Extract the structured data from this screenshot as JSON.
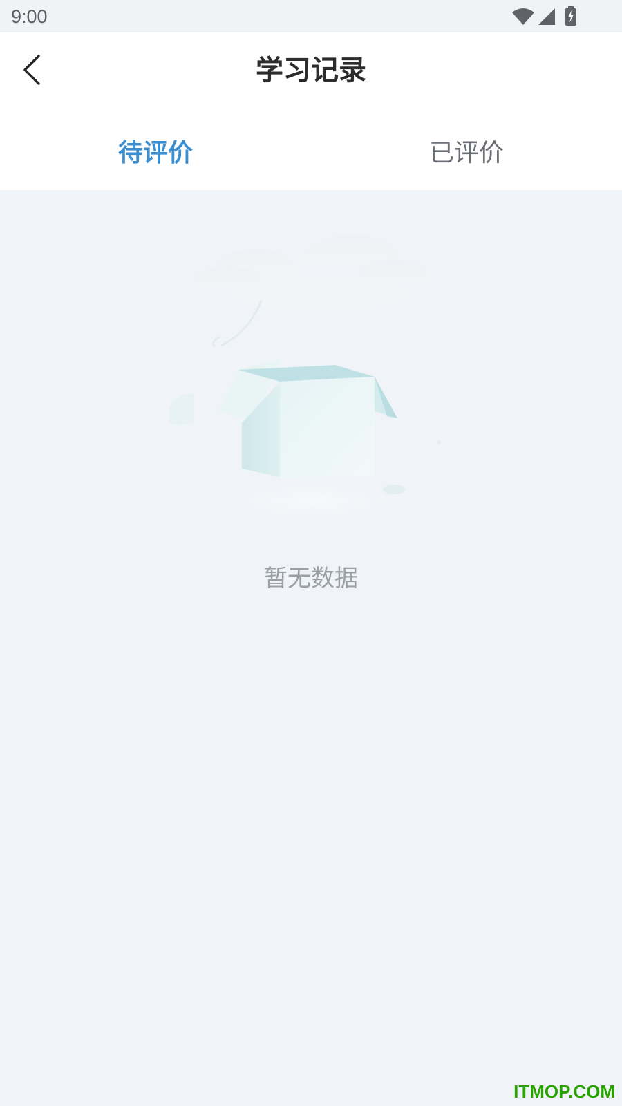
{
  "status_bar": {
    "time": "9:00",
    "icons": [
      "wifi-icon",
      "signal-icon",
      "battery-charging-icon"
    ]
  },
  "header": {
    "title": "学习记录",
    "back_icon": "chevron-left-icon"
  },
  "tabs": [
    {
      "label": "待评价",
      "selected": true
    },
    {
      "label": "已评价",
      "selected": false
    }
  ],
  "empty_state": {
    "illustration": "empty-box-illustration",
    "message": "暂无数据"
  },
  "watermark": "ITMOP.COM",
  "colors": {
    "accent": "#3b8ed0",
    "background": "#f0f4f8",
    "watermark": "#2aa300",
    "muted_text": "#9aa0a6"
  }
}
